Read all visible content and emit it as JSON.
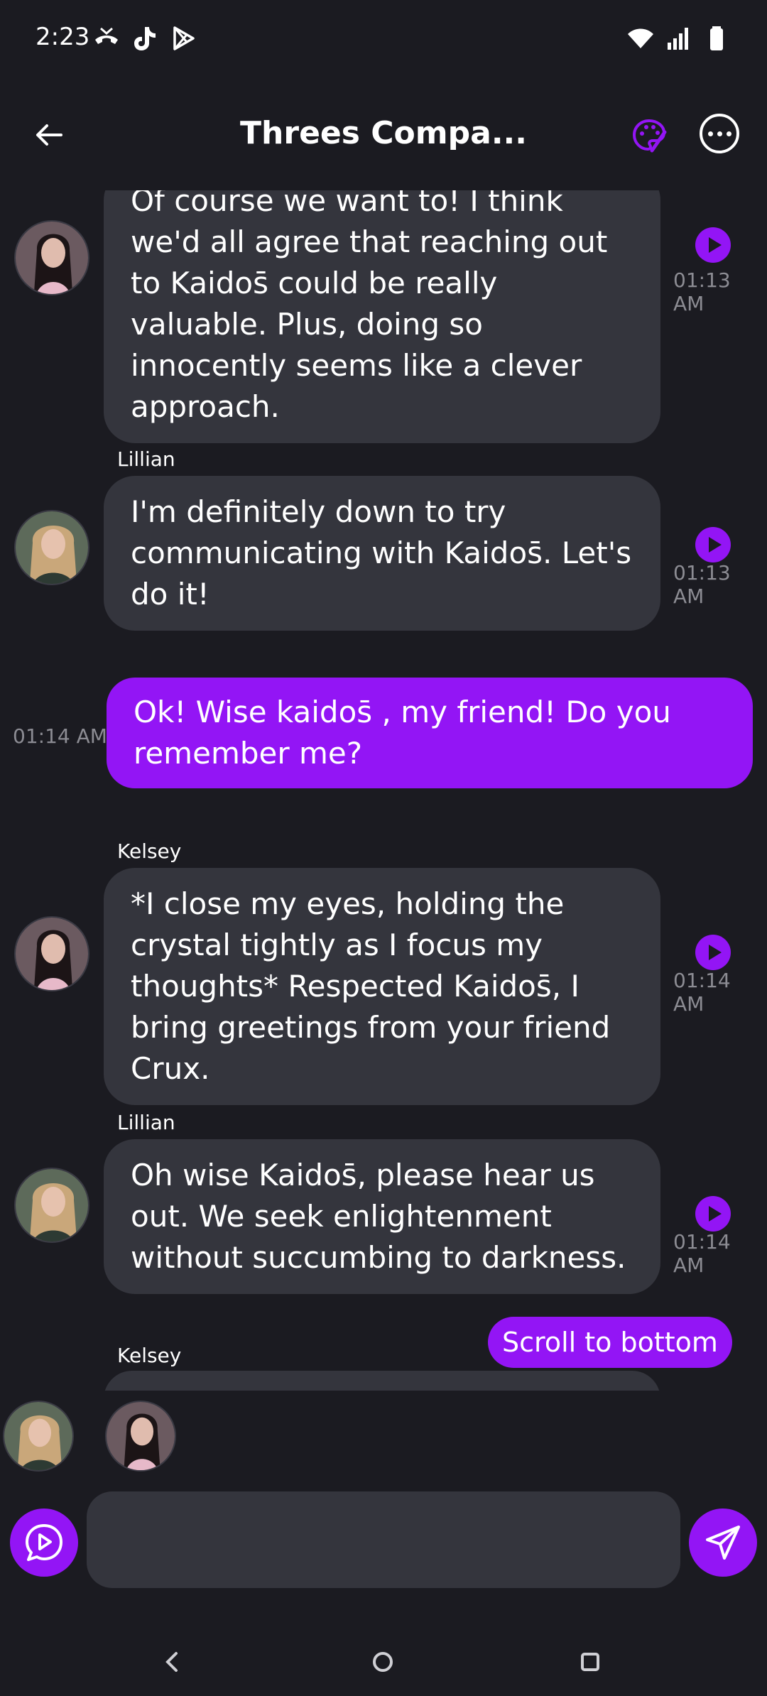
{
  "status_bar": {
    "time": "2:23",
    "left_icons": [
      "missed-call-icon",
      "tiktok-icon",
      "play-store-icon"
    ],
    "right_icons": [
      "wifi-icon",
      "signal-icon",
      "battery-icon"
    ]
  },
  "header": {
    "title": "Threes Compa...",
    "back_icon": "arrow-left-icon",
    "palette_icon": "palette-icon",
    "more_icon": "more-horizontal-icon"
  },
  "colors": {
    "accent": "#9315f5",
    "background": "#1b1b21",
    "bubble": "#34353d",
    "muted_text": "#8c8c93"
  },
  "messages": [
    {
      "sender": "",
      "avatar": "kelsey-avatar",
      "text": "Of course we want to! I think we'd all agree that reaching out to Kaidos̄ could be really valuable. Plus, doing so innocently seems like a clever approach.",
      "time": "01:13 AM"
    },
    {
      "sender": "Lillian",
      "avatar": "lillian-avatar",
      "text": "I'm definitely down to try communicating with Kaidos̄. Let's do it!",
      "time": "01:13 AM"
    },
    {
      "sender": "",
      "mine": true,
      "text": "Ok! Wise kaidos̄ , my friend! Do you remember me?",
      "time": "01:14 AM"
    },
    {
      "sender": "Kelsey",
      "avatar": "kelsey-avatar",
      "text": "*I close my eyes, holding the crystal tightly as I focus my thoughts* Respected Kaidos̄, I bring greetings from your friend Crux.",
      "time": "01:14 AM"
    },
    {
      "sender": "Lillian",
      "avatar": "lillian-avatar",
      "text": "Oh wise Kaidos̄, please hear us out. We seek enlightenment without succumbing to darkness.",
      "time": "01:14 AM"
    },
    {
      "sender": "Kelsey",
      "avatar": "kelsey-avatar",
      "text": "",
      "time": ""
    }
  ],
  "scroll_to_bottom_label": "Scroll to bottom",
  "participants": [
    "lillian-avatar",
    "kelsey-avatar"
  ],
  "composer": {
    "placeholder": "",
    "voice_icon": "voice-chat-icon",
    "send_icon": "send-icon"
  },
  "nav": [
    "back-nav-icon",
    "home-nav-icon",
    "recents-nav-icon"
  ]
}
